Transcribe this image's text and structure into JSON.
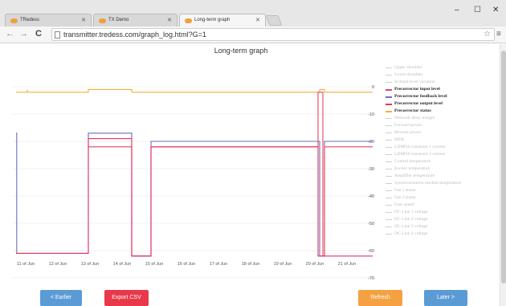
{
  "browser": {
    "tabs": [
      {
        "label": "TRedess"
      },
      {
        "label": "TX Demo"
      },
      {
        "label": "Long-term graph"
      }
    ],
    "url": "transmitter.tredess.com/graph_log.html?G=1"
  },
  "page": {
    "title": "Long-term graph"
  },
  "buttons": {
    "earlier": "< Earlier",
    "export": "Export CSV",
    "refresh": "Refresh",
    "later": "Later >"
  },
  "legend": [
    {
      "label": "Upper shoulder",
      "active": false,
      "color": "#cfcfcf"
    },
    {
      "label": "Lower shoulder",
      "active": false,
      "color": "#cfcfcf"
    },
    {
      "label": "In-band level variation",
      "active": false,
      "color": "#cfcfcf"
    },
    {
      "label": "Precorrector input level",
      "active": true,
      "color": "#e8455c"
    },
    {
      "label": "Precorrector feedback level",
      "active": true,
      "color": "#6a6fb8"
    },
    {
      "label": "Precorrector output level",
      "active": true,
      "color": "#e7345f"
    },
    {
      "label": "Precorrector status",
      "active": true,
      "color": "#f0b13d"
    },
    {
      "label": "Network delay margin",
      "active": false,
      "color": "#cfcfcf"
    },
    {
      "label": "Forward power",
      "active": false,
      "color": "#cfcfcf"
    },
    {
      "label": "Reverse power",
      "active": false,
      "color": "#cfcfcf"
    },
    {
      "label": "MER",
      "active": false,
      "color": "#cfcfcf"
    },
    {
      "label": "LDMOS transistor 1 current",
      "active": false,
      "color": "#cfcfcf"
    },
    {
      "label": "LDMOS transistor 2 current",
      "active": false,
      "color": "#cfcfcf"
    },
    {
      "label": "Control temperature",
      "active": false,
      "color": "#cfcfcf"
    },
    {
      "label": "Exciter temperature",
      "active": false,
      "color": "#cfcfcf"
    },
    {
      "label": "Amplifier temperature",
      "active": false,
      "color": "#cfcfcf"
    },
    {
      "label": "Synchronization module temperature",
      "active": false,
      "color": "#cfcfcf"
    },
    {
      "label": "Fan 1 status",
      "active": false,
      "color": "#cfcfcf"
    },
    {
      "label": "Fan 2 status",
      "active": false,
      "color": "#cfcfcf"
    },
    {
      "label": "Fans speed",
      "active": false,
      "color": "#cfcfcf"
    },
    {
      "label": "DC Line 1 voltage",
      "active": false,
      "color": "#cfcfcf"
    },
    {
      "label": "DC Line 2 voltage",
      "active": false,
      "color": "#cfcfcf"
    },
    {
      "label": "DC Line 3 voltage",
      "active": false,
      "color": "#cfcfcf"
    },
    {
      "label": "DC Line 4 voltage",
      "active": false,
      "color": "#cfcfcf"
    }
  ],
  "chart_data": {
    "type": "line",
    "title": "Long-term graph",
    "categories": [
      "11 of Jun",
      "12 of Jun",
      "13 of Jun",
      "14 of Jun",
      "15 of Jun",
      "16 of Jun",
      "17 of Jun",
      "18 of Jun",
      "19 of Jun",
      "20 of Jun",
      "21 of Jun"
    ],
    "ylim": [
      -70,
      0
    ],
    "y_ticks": [
      "0",
      "-10",
      "-20",
      "-30",
      "-40",
      "-50",
      "-60",
      "-70"
    ],
    "grid": true,
    "legend_position": "right",
    "series": [
      {
        "name": "Precorrector status",
        "color": "#f0b13d",
        "points": [
          [
            10.7,
            -2
          ],
          [
            11.05,
            -2
          ],
          [
            11.05,
            -1
          ],
          [
            11.05,
            -1
          ],
          [
            11.05,
            -2
          ],
          [
            12.95,
            -2
          ],
          [
            12.95,
            -1
          ],
          [
            14.3,
            -1
          ],
          [
            14.3,
            -2
          ],
          [
            20.15,
            -2
          ],
          [
            20.15,
            -1
          ],
          [
            20.3,
            -1
          ],
          [
            20.3,
            -2
          ],
          [
            21.8,
            -2
          ]
        ]
      },
      {
        "name": "Precorrector feedback level",
        "color": "#6a6fb8",
        "points": [
          [
            10.7,
            -17
          ],
          [
            10.72,
            -17
          ],
          [
            10.72,
            -61
          ],
          [
            12.95,
            -61
          ],
          [
            12.95,
            -17
          ],
          [
            14.3,
            -17
          ],
          [
            14.3,
            -62
          ],
          [
            14.9,
            -62
          ],
          [
            14.9,
            -20
          ],
          [
            20.15,
            -20
          ],
          [
            20.15,
            -62
          ],
          [
            20.3,
            -62
          ],
          [
            20.3,
            -20
          ],
          [
            21.8,
            -20
          ]
        ]
      },
      {
        "name": "Precorrector input level",
        "color": "#e8455c",
        "points": [
          [
            12.95,
            -22
          ],
          [
            14.3,
            -22
          ],
          [
            14.3,
            -62
          ],
          [
            14.9,
            -62
          ],
          [
            14.9,
            -22
          ],
          [
            20.1,
            -22
          ],
          [
            20.1,
            -2
          ],
          [
            20.25,
            -2
          ],
          [
            20.25,
            -62
          ],
          [
            20.3,
            -62
          ],
          [
            20.3,
            -22
          ],
          [
            21.8,
            -22
          ]
        ]
      },
      {
        "name": "Precorrector output level",
        "color": "#e7345f",
        "points": [
          [
            10.7,
            -61
          ],
          [
            12.95,
            -61
          ],
          [
            12.95,
            -19
          ],
          [
            14.3,
            -19
          ],
          [
            14.3,
            -62
          ],
          [
            14.9,
            -62
          ],
          [
            14.9,
            -22
          ],
          [
            20.1,
            -22
          ],
          [
            20.1,
            -62
          ],
          [
            21.8,
            -62
          ]
        ]
      }
    ]
  }
}
